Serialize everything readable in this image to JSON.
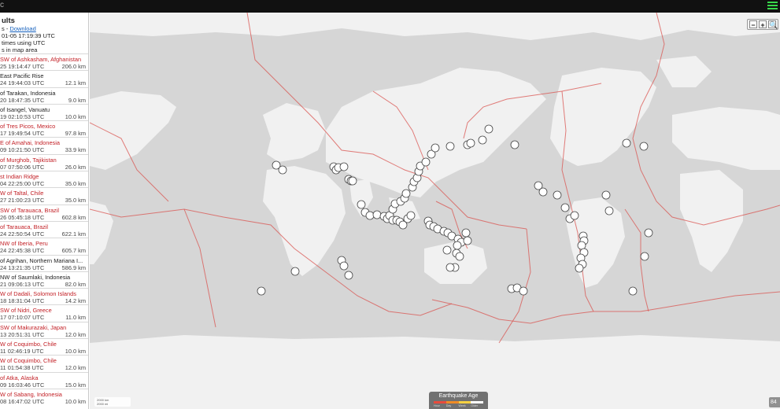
{
  "topbar": {
    "left_glyph": "c",
    "list_icon": "list-icon"
  },
  "sidebar": {
    "title": "ults",
    "download_prefix": "s - ",
    "download_label": "Download",
    "updated": "01-05 17:19:39 UTC",
    "times_note": "times using UTC",
    "area_note": "s in map area",
    "events": [
      {
        "place": "SW of Ashkasham, Afghanistan",
        "time": "25 19:14:47 UTC",
        "depth": "206.0 km",
        "red": true
      },
      {
        "place": "East Pacific Rise",
        "time": "24 19:44:03 UTC",
        "depth": "12.1 km",
        "red": false
      },
      {
        "place": "of Tarakan, Indonesia",
        "time": "20 18:47:35 UTC",
        "depth": "9.0 km",
        "red": false
      },
      {
        "place": "of Isangel, Vanuatu",
        "time": "19 02:10:53 UTC",
        "depth": "10.0 km",
        "red": false
      },
      {
        "place": "of Tres Picos, Mexico",
        "time": "17 19:49:54 UTC",
        "depth": "97.8 km",
        "red": true
      },
      {
        "place": "E of Amahai, Indonesia",
        "time": "09 10:21:50 UTC",
        "depth": "33.9 km",
        "red": true
      },
      {
        "place": "of Murghob, Tajikistan",
        "time": "07 07:50:06 UTC",
        "depth": "26.0 km",
        "red": true
      },
      {
        "place": "st Indian Ridge",
        "time": "04 22:25:00 UTC",
        "depth": "35.0 km",
        "red": true
      },
      {
        "place": "W of Taltal, Chile",
        "time": "27 21:00:23 UTC",
        "depth": "35.0 km",
        "red": true
      },
      {
        "place": "SW of Tarauaca, Brazil",
        "time": "26 05:45:18 UTC",
        "depth": "602.8 km",
        "red": true
      },
      {
        "place": "of Tarauaca, Brazil",
        "time": "24 22:50:54 UTC",
        "depth": "622.1 km",
        "red": true
      },
      {
        "place": "NW of Iberia, Peru",
        "time": "24 22:45:38 UTC",
        "depth": "605.7 km",
        "red": true
      },
      {
        "place": "of Agrihan, Northern Mariana I...",
        "time": "24 13:21:35 UTC",
        "depth": "586.9 km",
        "red": false
      },
      {
        "place": "NW of Saumlaki, Indonesia",
        "time": "21 09:06:13 UTC",
        "depth": "82.0 km",
        "red": false
      },
      {
        "place": "W of Dadali, Solomon Islands",
        "time": "18 18:31:04 UTC",
        "depth": "14.2 km",
        "red": true
      },
      {
        "place": "SW of Nidri, Greece",
        "time": "17 07:10:07 UTC",
        "depth": "11.0 km",
        "red": true
      },
      {
        "place": "SW of Makurazaki, Japan",
        "time": "13 20:51:31 UTC",
        "depth": "12.0 km",
        "red": true
      },
      {
        "place": "W of Coquimbo, Chile",
        "time": "11 02:46:19 UTC",
        "depth": "10.0 km",
        "red": true
      },
      {
        "place": "W of Coquimbo, Chile",
        "time": "11 01:54:38 UTC",
        "depth": "12.0 km",
        "red": true
      },
      {
        "place": "of Atka, Alaska",
        "time": "09 16:03:46 UTC",
        "depth": "15.0 km",
        "red": true
      },
      {
        "place": "W of Sabang, Indonesia",
        "time": "08 16:47:02 UTC",
        "depth": "10.0 km",
        "red": true
      }
    ]
  },
  "map": {
    "zoom_out": "−",
    "zoom_in": "+",
    "zoom_search": "🔍",
    "scale_top": "2000 km",
    "scale_bottom": "2000 mi",
    "legend": {
      "title": "Earthquake Age",
      "items": [
        {
          "label": "Hour",
          "color": "#e84b3c"
        },
        {
          "label": "Day",
          "color": "#f08c26"
        },
        {
          "label": "Week",
          "color": "#f5d142"
        },
        {
          "label": "Older",
          "color": "#ffffff"
        }
      ]
    },
    "count_label": "84",
    "colors": {
      "ocean": "#d6d6d6",
      "land": "#f1f1f1",
      "plate": "#d9534f",
      "marker": "#ffffff"
    }
  }
}
